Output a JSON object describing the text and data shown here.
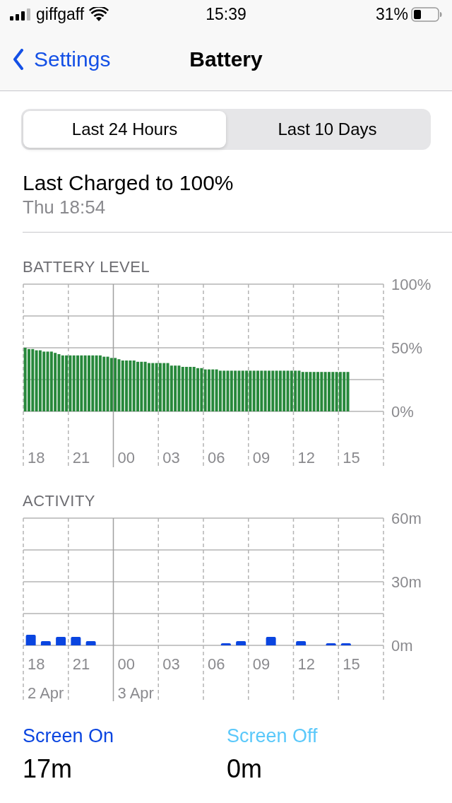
{
  "status_bar": {
    "carrier": "giffgaff",
    "time": "15:39",
    "battery": "31%"
  },
  "nav": {
    "back": "Settings",
    "title": "Battery"
  },
  "segments": [
    {
      "label": "Last 24 Hours",
      "selected": true
    },
    {
      "label": "Last 10 Days",
      "selected": false
    }
  ],
  "last_charged": {
    "title": "Last Charged to 100%",
    "time": "Thu 18:54"
  },
  "battery_level": {
    "title": "BATTERY LEVEL",
    "x_labels": [
      {
        "label": "18",
        "day_start": false
      },
      {
        "label": "21",
        "day_start": false
      },
      {
        "label": "00",
        "day_start": true
      },
      {
        "label": "03",
        "day_start": false
      },
      {
        "label": "06",
        "day_start": false
      },
      {
        "label": "09",
        "day_start": false
      },
      {
        "label": "12",
        "day_start": false
      },
      {
        "label": "15",
        "day_start": false
      }
    ],
    "chart_data": {
      "type": "bar",
      "ylim": [
        0,
        100
      ],
      "yticks": [
        {
          "value": 0,
          "label": "0%"
        },
        {
          "value": 50,
          "label": "50%"
        },
        {
          "value": 100,
          "label": "100%"
        }
      ],
      "series": [
        {
          "color": "#27883b",
          "values": [
            50,
            49,
            49,
            48,
            48,
            47,
            47,
            47,
            46,
            45,
            44,
            44,
            44,
            44,
            44,
            44,
            44,
            44,
            44,
            44,
            44,
            43,
            43,
            42,
            42,
            41,
            40,
            40,
            40,
            40,
            39,
            39,
            39,
            38,
            38,
            38,
            38,
            38,
            38,
            36,
            36,
            36,
            35,
            35,
            35,
            35,
            34,
            34,
            33,
            33,
            33,
            33,
            32,
            32,
            32,
            32,
            32,
            32,
            32,
            32,
            32,
            32,
            32,
            32,
            32,
            32,
            32,
            32,
            32,
            32,
            32,
            32,
            32,
            32,
            31,
            31,
            31,
            31,
            31,
            31,
            31,
            31,
            31,
            31,
            31,
            31,
            31,
            null,
            null,
            null,
            null,
            null,
            null,
            null,
            null,
            null
          ]
        }
      ]
    }
  },
  "activity": {
    "title": "ACTIVITY",
    "x_labels": [
      {
        "label": "18",
        "day_start": false,
        "date": "2 Apr"
      },
      {
        "label": "21",
        "day_start": false
      },
      {
        "label": "00",
        "day_start": true,
        "date": "3 Apr"
      },
      {
        "label": "03",
        "day_start": false
      },
      {
        "label": "06",
        "day_start": false
      },
      {
        "label": "09",
        "day_start": false
      },
      {
        "label": "12",
        "day_start": false
      },
      {
        "label": "15",
        "day_start": false
      }
    ],
    "chart_data": {
      "type": "bar",
      "ylim": [
        0,
        60
      ],
      "yticks": [
        {
          "value": 0,
          "label": "0m"
        },
        {
          "value": 30,
          "label": "30m"
        },
        {
          "value": 60,
          "label": "60m"
        }
      ],
      "series": [
        {
          "color": "#0a45e0",
          "values": [
            5,
            2,
            4,
            4,
            2,
            0,
            0,
            0,
            0,
            0,
            0,
            0,
            0,
            1,
            2,
            0,
            4,
            0,
            2,
            0,
            1,
            1,
            0,
            0
          ]
        }
      ]
    }
  },
  "legend": [
    {
      "label": "Screen On",
      "value": "17m",
      "color": "#0a45e0"
    },
    {
      "label": "Screen Off",
      "value": "0m",
      "color": "#5ac8fa"
    }
  ]
}
